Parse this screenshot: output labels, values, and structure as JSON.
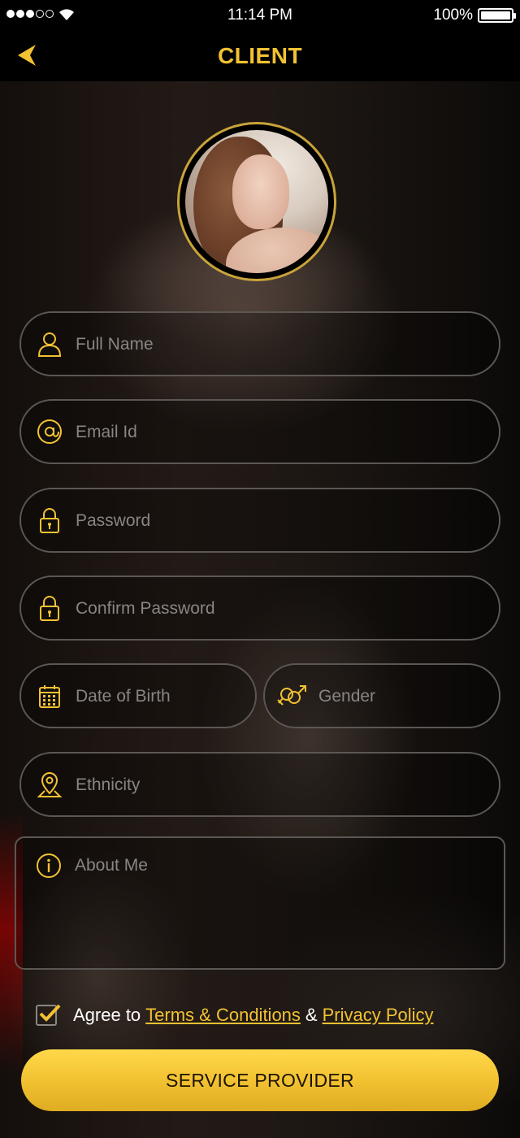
{
  "status_bar": {
    "time": "11:14 PM",
    "battery_percent": "100%",
    "signal_bars_filled": 3,
    "signal_bars_total": 5
  },
  "nav": {
    "title": "CLIENT"
  },
  "form": {
    "full_name": {
      "placeholder": "Full Name",
      "icon": "user-icon"
    },
    "email": {
      "placeholder": "Email Id",
      "icon": "at-icon"
    },
    "password": {
      "placeholder": "Password",
      "icon": "lock-icon"
    },
    "confirm_password": {
      "placeholder": "Confirm Password",
      "icon": "lock-icon"
    },
    "date_of_birth": {
      "placeholder": "Date of Birth",
      "icon": "calendar-icon"
    },
    "gender": {
      "placeholder": "Gender",
      "icon": "gender-icon"
    },
    "ethnicity": {
      "placeholder": "Ethnicity",
      "icon": "location-pin-icon"
    },
    "about_me": {
      "placeholder": "About Me",
      "icon": "info-icon"
    }
  },
  "agreement": {
    "checked": true,
    "prefix": "Agree to",
    "terms_link": "Terms & Conditions",
    "amp": "&",
    "privacy_link": "Privacy Policy"
  },
  "primary_button": {
    "label": "SERVICE PROVIDER"
  },
  "colors": {
    "accent": "#f2c232",
    "field_border": "#5b5754",
    "placeholder": "#888584"
  }
}
